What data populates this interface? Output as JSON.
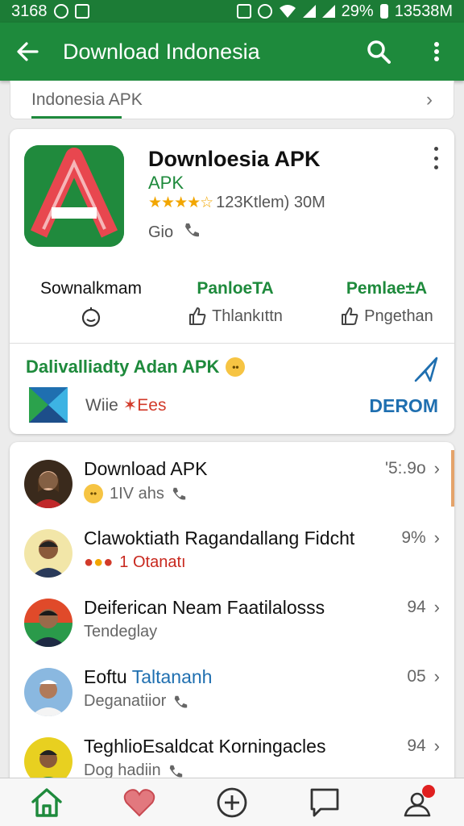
{
  "status_bar": {
    "left_text": "3168",
    "battery": "29%",
    "time": "1353",
    "time_suffix": "8M"
  },
  "app_bar": {
    "title": "Download Indonesia"
  },
  "search_card": {
    "text": "Indonesia APK"
  },
  "app": {
    "name": "Downloesia APK",
    "subtitle": "APK",
    "rating_text": "123Ktlem) 30M",
    "developer": "Gio"
  },
  "stats": [
    {
      "label": "Sownalkmam",
      "value": ""
    },
    {
      "label": "PanloeTA",
      "value": "Thlankıttn"
    },
    {
      "label": "Pemlae±A",
      "value": "Pngethan"
    }
  ],
  "promo": {
    "title": "Dalivalliadty Adan APK",
    "text_main": "Wiie",
    "text_red": "Ees",
    "action": "DEROM"
  },
  "list": [
    {
      "title": "Download APK",
      "sub": "1IV ahs",
      "meta": "'5:.9o"
    },
    {
      "title": "Clawoktiath Ragandallang Fidcht",
      "sub": "1 Otanatı",
      "meta": "9%"
    },
    {
      "title": "Deiferican Neam Faatilalosss",
      "sub": "Tendeglay",
      "meta": "94"
    },
    {
      "title_main": "Eoftu",
      "title_blue": "Taltananh",
      "sub": "Deganatiior",
      "meta": "05"
    },
    {
      "title": "TeghlioEsaldcat Korningacles",
      "sub": "Dog hadiin",
      "meta": "94"
    }
  ],
  "colors": {
    "primary_green": "#1e8a3c",
    "link_blue": "#1f6fb0",
    "star_gold": "#f2a600",
    "alert_red": "#e02020"
  }
}
